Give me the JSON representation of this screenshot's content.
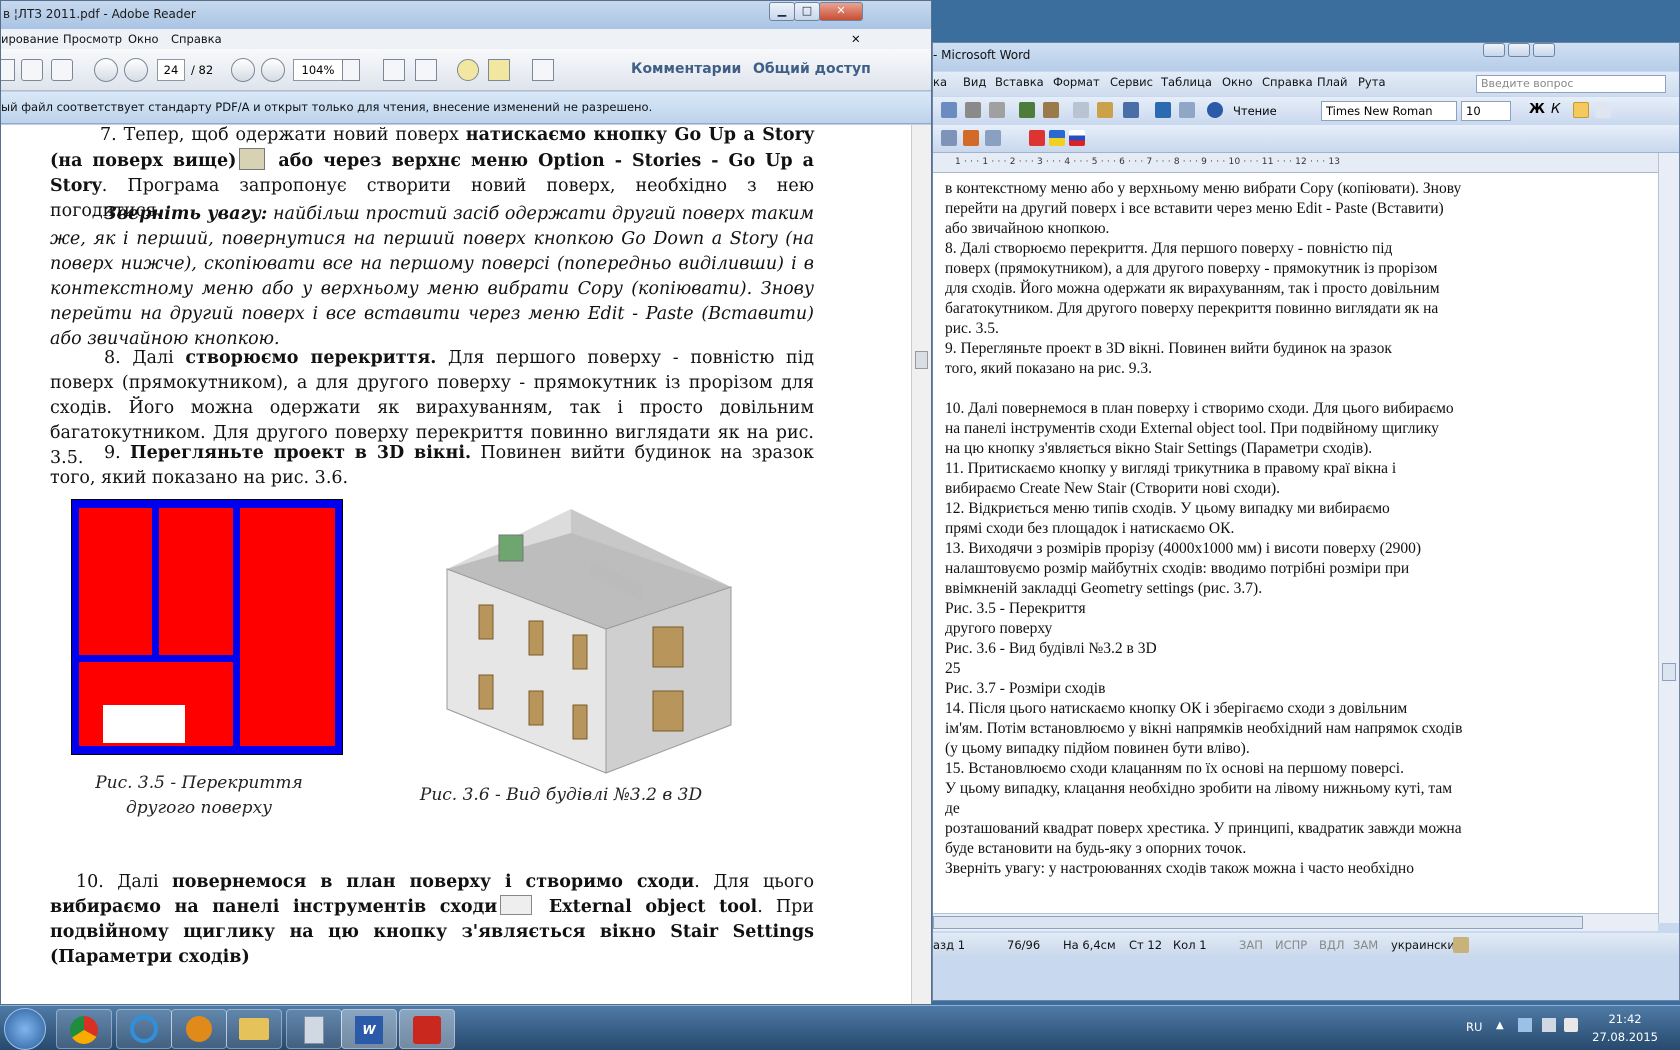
{
  "desktop": {
    "bg_color": "#3b6d9d"
  },
  "adobe": {
    "title": "в ¦ЛТЗ 2011.pdf - Adobe Reader",
    "window_controls": {
      "minimize": "▁",
      "maximize": "□",
      "close": "✕"
    },
    "menu": [
      "ирование",
      "Просмотр",
      "Окно",
      "Справка"
    ],
    "doc_close": "✕",
    "toolbar": {
      "page_current": "24",
      "page_total": "/ 82",
      "zoom": "104%",
      "comments": "Комментарии",
      "share": "Общий доступ"
    },
    "infobar": "ый файл соответствует стандарту PDF/A и открыт только для чтения, внесение изменений не разрешено.",
    "paragraphs": {
      "p7a": "7. Тепер, щоб одержати новий поверх ",
      "p7b": "натискаємо кнопку Go Up a Story (на поверх вище)",
      "p7c": " або через верхнє меню Option - Stories - Go Up a Story",
      "p7d": ". Програма запропонує створити новий поверх, необхідно з нею погодитися.",
      "noteA": "Зверніть увагу:",
      "noteB": " найбільш простий засіб одержати другий поверх таким же, як і перший, повернутися на перший поверх кнопкою Go Down a Story (на поверх нижче), скопіювати все на першому поверсі (попередньо виділивши) і в контекстному меню або у верхньому меню вибрати Copy (копіювати). Знову перейти на другий поверх і все вставити через меню Edit - Paste (Вставити) або звичайною кнопкою.",
      "p8a": "8. Далі ",
      "p8b": "створюємо перекриття.",
      "p8c": " Для першого поверху - повністю під поверх (прямокутником), а для другого поверху - прямокутник із прорізом для сходів. Його можна одержати як вирахуванням, так і просто довільним багатокутником. Для другого поверху перекриття повинно виглядати як на рис. 3.5.",
      "p9a": "9. ",
      "p9b": "Перегляньте проект в 3D вікні.",
      "p9c": " Повинен вийти будинок на зразок того, який показано на рис. 3.6.",
      "p10a": "10. Далі ",
      "p10b": "повернемося в план поверху і створимо сходи",
      "p10c": ". Для цього ",
      "p10d": "вибираємо на панелі інструментів сходи",
      "p10e": " External object tool",
      "p10f": ". При ",
      "p10g": "подвійному щиглику на цю кнопку з'являється вікно Stair Settings (Параметри сходів)"
    },
    "captions": {
      "fig35": "Рис. 3.5 - Перекриття\nдругого поверху",
      "fig36": "Рис. 3.6 - Вид будівлі №3.2 в 3D"
    },
    "colors": {
      "slab_red": "#ff0000",
      "slab_blue": "#0000ee"
    }
  },
  "word": {
    "title": "- Microsoft Word",
    "menu": [
      "ка",
      "Вид",
      "Вставка",
      "Формат",
      "Сервис",
      "Таблица",
      "Окно",
      "Справка",
      "Плай",
      "Рута"
    ],
    "help_placeholder": "Введите вопрос",
    "toolbar": {
      "reading": "Чтение",
      "font": "Times New Roman",
      "size": "10"
    },
    "ruler_text": "1 · · · 1 · · · 2 · · · 3 · · · 4 · · · 5 · · · 6 · · · 7 · · · 8 · · · 9 · · · 10 · · · 11 · · · 12 · · · 13",
    "lines": [
      "в контекстному меню або у верхньому меню вибрати Copy (копіювати). Знову",
      "перейти на другий поверх і все вставити через меню Edit - Paste (Вставити)",
      "або звичайною кнопкою.",
      "            8. Далі створюємо перекриття. Для першого поверху - повністю під",
      "поверх (прямокутником), а для другого поверху - прямокутник із прорізом",
      "для сходів. Його можна одержати як вирахуванням, так і просто довільним",
      "багатокутником. Для другого поверху перекриття повинно виглядати як на",
      "рис. 3.5.",
      "            9. Перегляньте проект в 3D вікні. Повинен вийти будинок на зразок",
      "того, який показано на рис. 9.3.",
      "",
      "10. Далі повернемося в план поверху і створимо сходи. Для цього вибираємо",
      "на панелі інструментів сходи External object tool. При подвійному щиглику",
      "на цю кнопку з'являється вікно Stair Settings (Параметри сходів).",
      "11. Притискаємо кнопку у вигляді трикутника в правому краї вікна і",
      "вибираємо Create New Stair (Створити нові сходи).",
      "12. Відкриється меню типів сходів. У цьому випадку ми вибираємо",
      "прямі сходи без площадок і натискаємо ОК.",
      "13. Виходячи з розмірів прорізу (4000x1000 мм) і висоти поверху (2900)",
      "налаштовуємо розмір майбутніх сходів: вводимо потрібні розміри при",
      "ввімкненій закладці Geometry settings (рис. 3.7).",
      "Рис. 3.5 - Перекриття",
      "другого поверху",
      "Рис. 3.6 - Вид будівлі №3.2 в 3D",
      "25",
      "Рис. 3.7 - Розміри сходів",
      "14. Після цього натискаємо кнопку ОК і зберігаємо сходи з довільним",
      "ім'ям. Потім встановлюємо у вікні напрямків необхідний нам напрямок сходів",
      "(у цьому випадку підйом повинен бути вліво).",
      "15. Встановлюємо сходи клацанням по їх основі на першому поверсі.",
      "У цьому випадку, клацання необхідно зробити на лівому нижньому куті, там",
      "де",
      "розташований квадрат поверх хрестика. У принципі, квадратик завжди можна",
      "буде встановити на будь-яку з опорних точок.",
      "Зверніть увагу: у настроюваннях сходів також можна і часто необхідно"
    ],
    "status": {
      "section": "азд 1",
      "pages": "76/96",
      "at": "На 6,4см",
      "line": "Ст 12",
      "col": "Кол 1",
      "rec": "ЗАП",
      "trk": "ИСПР",
      "ext": "ВДЛ",
      "ovr": "ЗАМ",
      "lang": "украинский"
    }
  },
  "taskbar": {
    "lang": "RU",
    "time": "21:42",
    "date": "27.08.2015"
  }
}
